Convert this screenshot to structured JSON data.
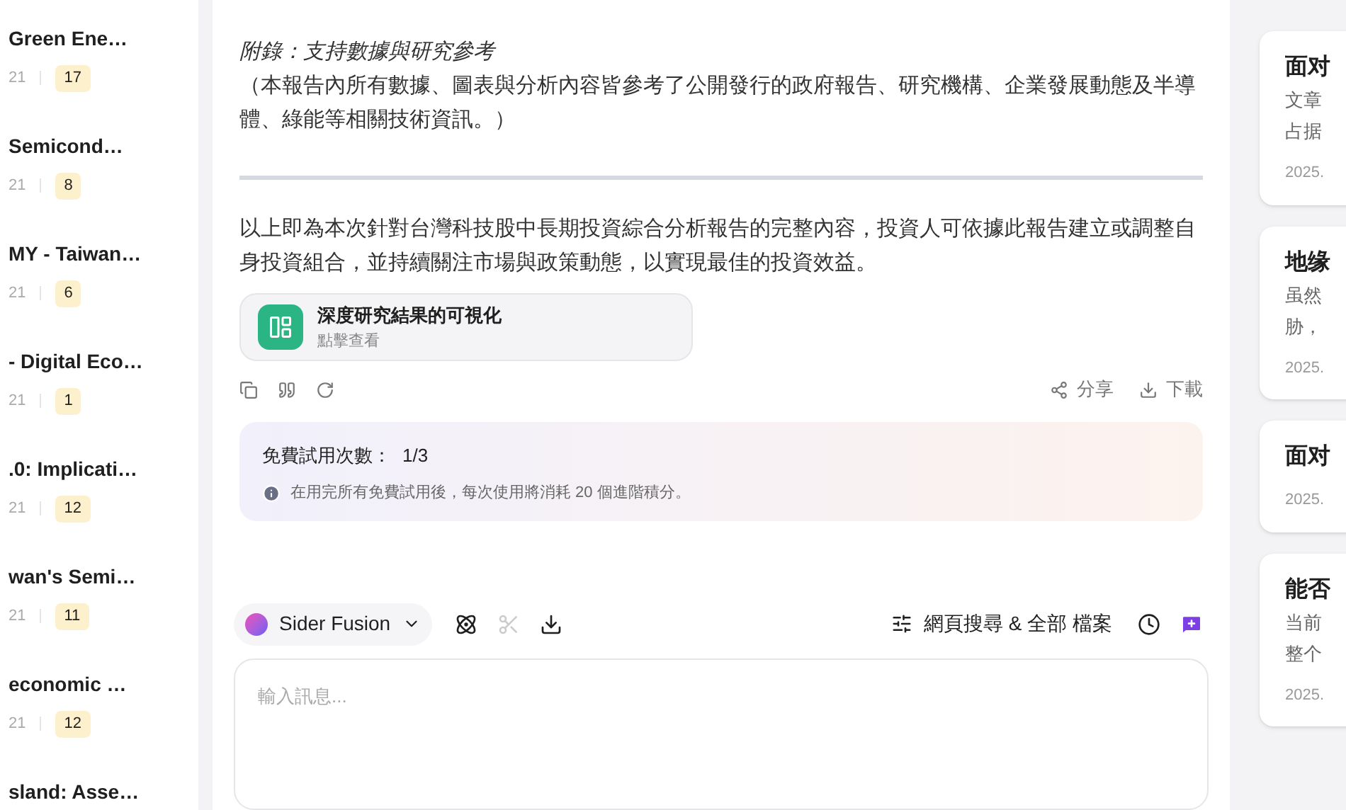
{
  "left_list": [
    {
      "title": "Green Ene…",
      "date": "21",
      "count": "17"
    },
    {
      "title": "Semicond…",
      "date": "21",
      "count": "8"
    },
    {
      "title": "MY - Taiwan…",
      "date": "21",
      "count": "6"
    },
    {
      "title": "- Digital Eco…",
      "date": "21",
      "count": "1"
    },
    {
      "title": ".0: Implicati…",
      "date": "21",
      "count": "12"
    },
    {
      "title": "wan's Semi…",
      "date": "21",
      "count": "11"
    },
    {
      "title": "economic …",
      "date": "21",
      "count": "12"
    },
    {
      "title": "sland: Asse…"
    }
  ],
  "message": {
    "appendix_title": "附錄：支持數據與研究參考",
    "appendix_note": "（本報告內所有數據、圖表與分析內容皆參考了公開發行的政府報告、研究機構、企業發展動態及半導體、綠能等相關技術資訊。）",
    "conclusion": "以上即為本次針對台灣科技股中長期投資綜合分析報告的完整內容，投資人可依據此報告建立或調整自身投資組合，並持續關注市場與政策動態，以實現最佳的投資效益。",
    "card": {
      "title": "深度研究結果的可視化",
      "subtitle": "點擊查看"
    },
    "share": "分享",
    "download": "下載"
  },
  "trial": {
    "label": "免費試用次數：",
    "count": "1/3",
    "note": "在用完所有免費試用後，每次使用將消耗 20 個進階積分。"
  },
  "composer": {
    "model": "Sider Fusion",
    "search": "網頁搜尋 & 全部 檔案",
    "placeholder": "輸入訊息..."
  },
  "right_cards": [
    {
      "title": "面对",
      "lines": [
        "文章",
        "占据"
      ],
      "date": "2025."
    },
    {
      "title": "地缘",
      "lines": [
        "虽然",
        "胁，"
      ],
      "date": "2025."
    },
    {
      "title": "面对",
      "date": "2025."
    },
    {
      "title": "能否",
      "lines": [
        "当前",
        "整个"
      ],
      "date": "2025."
    }
  ]
}
